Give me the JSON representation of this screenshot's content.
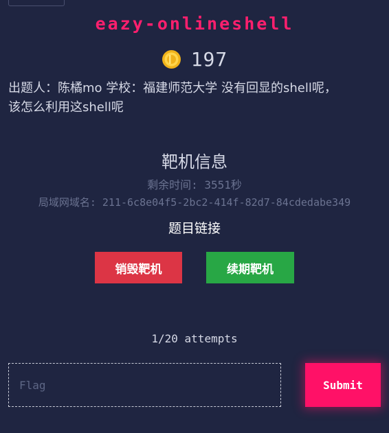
{
  "challenge": {
    "title": "eazy-onlineshell",
    "points": "197",
    "description_line1": "出题人：陈橘mo 学校：福建师范大学 没有回显的shell呢，",
    "description_line2": "该怎么利用这shell呢"
  },
  "target": {
    "section_title": "靶机信息",
    "remaining_time": "剩余时间: 3551秒",
    "domain": "局域网域名: 211-6c8e04f5-2bc2-414f-82d7-84cdedabe349",
    "link_label": "题目链接",
    "destroy_label": "销毁靶机",
    "renew_label": "续期靶机"
  },
  "submission": {
    "attempts": "1/20 attempts",
    "flag_placeholder": "Flag",
    "submit_label": "Submit"
  },
  "icons": {
    "points_icon": "coin-icon"
  },
  "colors": {
    "background": "#1f2541",
    "title_accent": "#ff1f6e",
    "destroy_button": "#dc3545",
    "renew_button": "#28a745",
    "submit_button": "#ff1167"
  }
}
